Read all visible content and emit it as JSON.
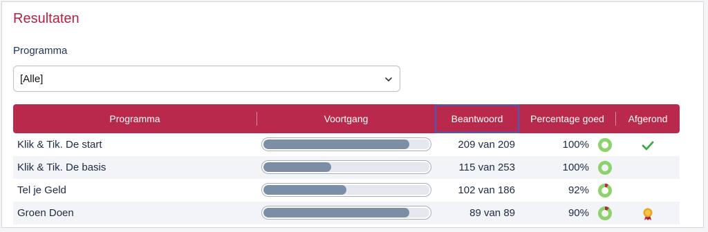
{
  "page": {
    "title": "Resultaten"
  },
  "filter": {
    "label": "Programma",
    "selected": "[Alle]",
    "icon": "chevron-down-icon"
  },
  "table": {
    "headers": {
      "programma": "Programma",
      "voortgang": "Voortgang",
      "beantwoord": "Beantwoord",
      "percentage": "Percentage goed",
      "afgerond": "Afgerond"
    },
    "rows": [
      {
        "programma": "Klik & Tik. De start",
        "progress": 0.88,
        "beantwoord": "209 van 209",
        "percentage": "100%",
        "ring_wrong": 0.0,
        "status_icon": "check-icon"
      },
      {
        "programma": "Klik & Tik. De basis",
        "progress": 0.41,
        "beantwoord": "115 van 253",
        "percentage": "100%",
        "ring_wrong": 0.0,
        "status_icon": ""
      },
      {
        "programma": "Tel je Geld",
        "progress": 0.5,
        "beantwoord": "102 van 186",
        "percentage": "92%",
        "ring_wrong": 0.08,
        "status_icon": ""
      },
      {
        "programma": "Groen Doen",
        "progress": 0.88,
        "beantwoord": "89 van 89",
        "percentage": "90%",
        "ring_wrong": 0.1,
        "status_icon": "award-medal-icon"
      }
    ]
  },
  "colors": {
    "brand": "#b9294c",
    "title": "#b51f42",
    "bar_fill": "#7c8ea6",
    "ring_good": "#8bd36a",
    "ring_wrong": "#c2203a",
    "check": "#3aa84a",
    "medal": "#e8a623"
  }
}
